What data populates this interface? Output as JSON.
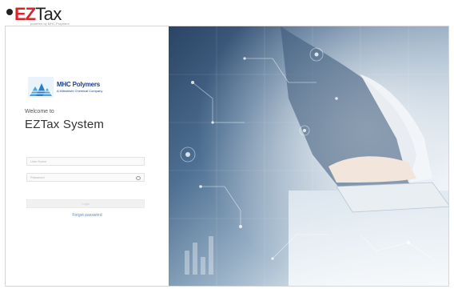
{
  "brand": {
    "ez": "EZ",
    "tax": "Tax",
    "tagline": "powered by MHC Polymers"
  },
  "company": {
    "name": "MHC Polymers",
    "subtitle": "A Mitsubishi Chemical Company"
  },
  "login": {
    "welcome": "Welcome to",
    "title": "EZTax System",
    "username_placeholder": "User Name",
    "password_placeholder": "Password",
    "login_button": "Login",
    "forgot_link": "Forgot password"
  },
  "colors": {
    "brand_red": "#d8232a",
    "link_blue": "#4b8fd6",
    "logo_blue": "#1b3f8f"
  },
  "icons": {
    "password_toggle": "eye-icon",
    "company_logo": "mountain-logo-icon"
  }
}
